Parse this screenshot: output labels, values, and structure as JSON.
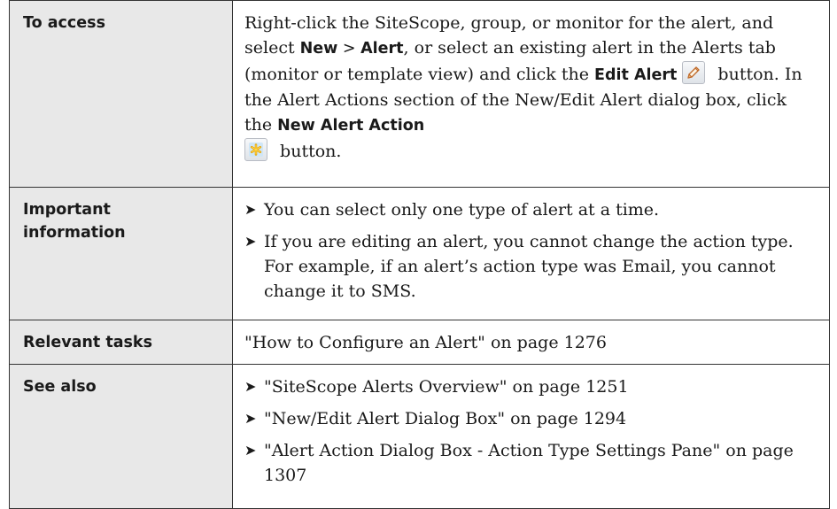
{
  "rows": {
    "access": {
      "label": "To access",
      "seg1": "Right-click the SiteScope, group, or monitor for the alert, and select ",
      "new_label": "New",
      "sep": " > ",
      "alert_label": "Alert",
      "seg2": ", or select an existing alert in the Alerts tab (monitor or template view) and click the ",
      "edit_alert_label": "Edit Alert",
      "seg3": " button. In the Alert Actions section of the New/Edit Alert dialog box, click the ",
      "new_alert_action_label": "New Alert Action",
      "seg4": " button.",
      "edit_icon": "pencil-icon",
      "new_icon": "asterisk-icon"
    },
    "important": {
      "label_line1": "Important",
      "label_line2": "information",
      "bullets": [
        "You can select only one type of alert at a time.",
        "If you are editing an alert, you cannot change the action type. For example, if an alert’s action type was Email, you cannot change it to SMS."
      ]
    },
    "tasks": {
      "label": "Relevant tasks",
      "text": "\"How to Configure an Alert\" on page 1276"
    },
    "see_also": {
      "label": "See also",
      "bullets": [
        "\"SiteScope Alerts Overview\" on page 1251",
        "\"New/Edit Alert Dialog Box\" on page 1294",
        "\"Alert Action Dialog Box - Action Type Settings Pane\" on page 1307"
      ]
    }
  },
  "bullet_glyph": "➤",
  "colors": {
    "label_bg": "#e8e8e8",
    "border": "#333333",
    "text": "#1a1a1a"
  }
}
